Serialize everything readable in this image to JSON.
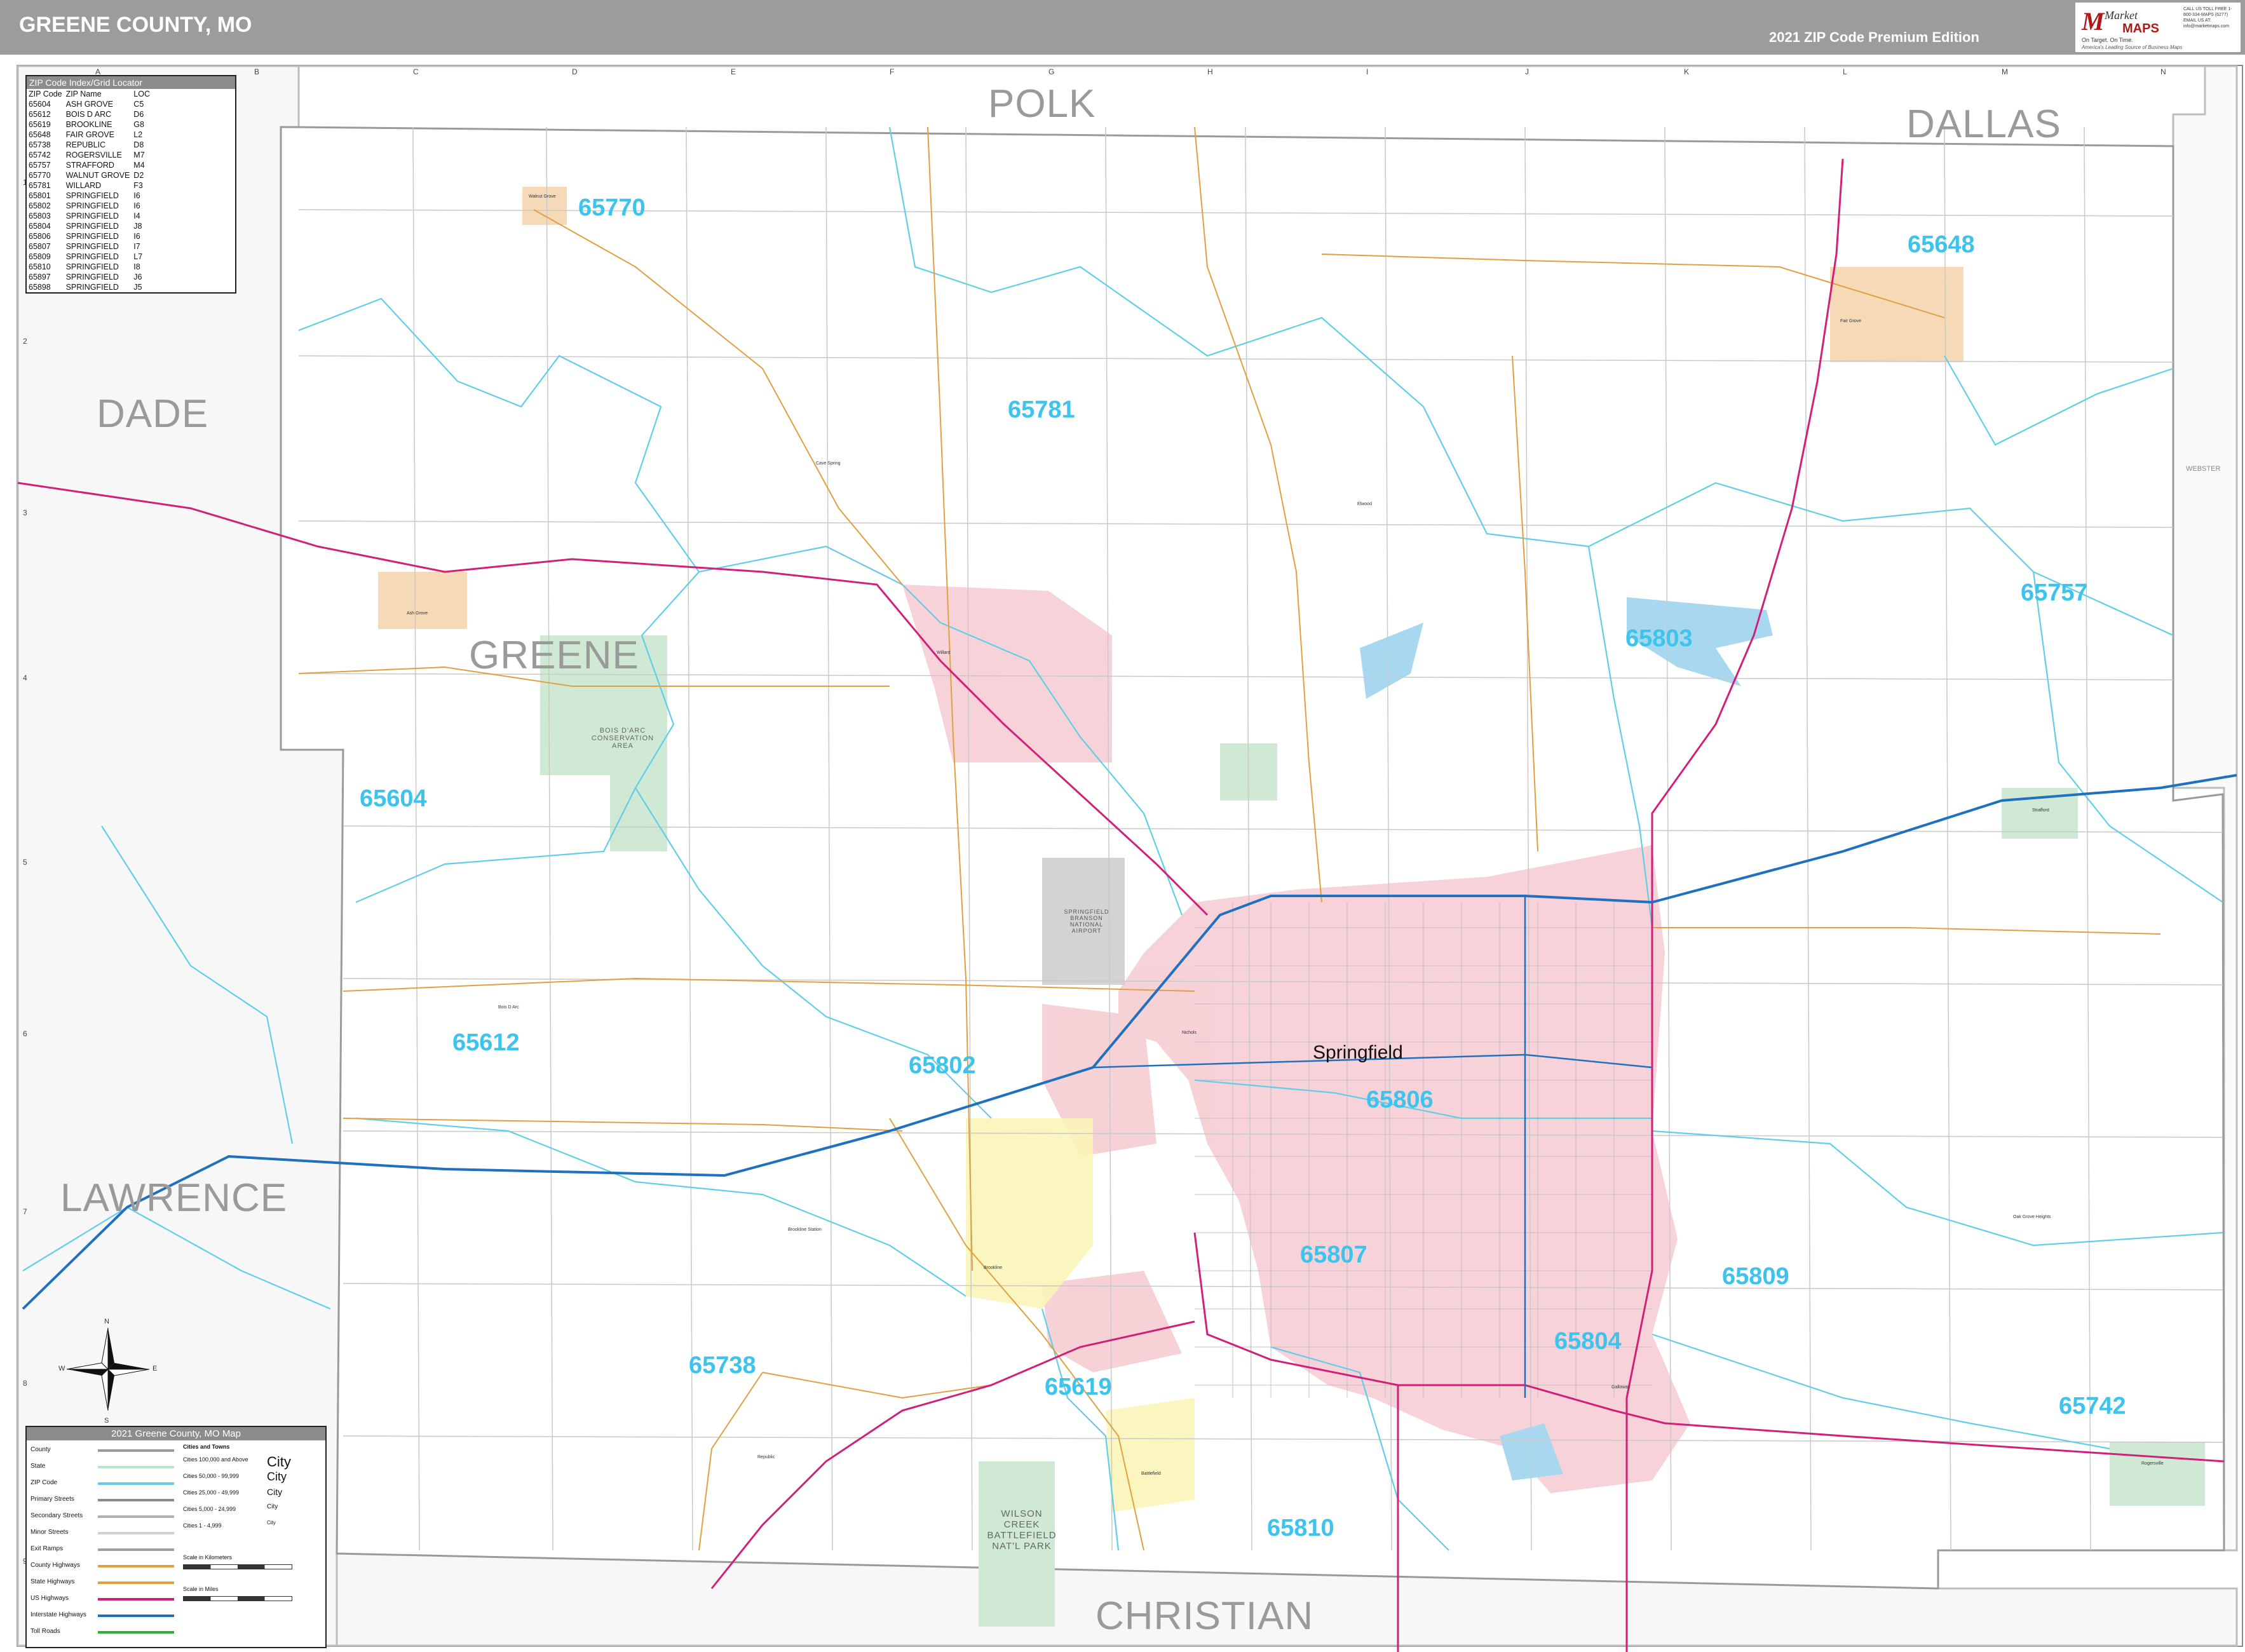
{
  "header": {
    "title": "GREENE COUNTY, MO",
    "edition": "2021 ZIP Code Premium Edition"
  },
  "logo": {
    "market": "Market",
    "maps": "MAPS",
    "tagline1": "On Target. On Time.",
    "tagline2": "America's Leading Source of Business Maps",
    "contact": "CALL US TOLL FREE 1-800-334-MAPS (6277) EMAIL US AT: info@marketmaps.com"
  },
  "grid": {
    "letters": [
      "A",
      "B",
      "C",
      "D",
      "E",
      "F",
      "G",
      "H",
      "I",
      "J",
      "K",
      "L",
      "M",
      "N"
    ],
    "numbers": [
      "1",
      "2",
      "3",
      "4",
      "5",
      "6",
      "7",
      "8",
      "9"
    ]
  },
  "counties": {
    "polk": "POLK",
    "dallas": "DALLAS",
    "dade": "DADE",
    "greene": "GREENE",
    "lawrence": "LAWRENCE",
    "christian": "CHRISTIAN",
    "webster": "WEBSTER"
  },
  "zip_labels": {
    "z65770": "65770",
    "z65648": "65648",
    "z65781": "65781",
    "z65757": "65757",
    "z65803": "65803",
    "z65604": "65604",
    "z65612": "65612",
    "z65802": "65802",
    "z65806": "65806",
    "z65807": "65807",
    "z65809": "65809",
    "z65804": "65804",
    "z65738": "65738",
    "z65619": "65619",
    "z65742": "65742",
    "z65810": "65810"
  },
  "city": {
    "springfield": "Springfield"
  },
  "places": {
    "walnut_grove": "Walnut Grove",
    "fair_grove": "Fair Grove",
    "ash_grove": "Ash Grove",
    "willard": "Willard",
    "strafford": "Strafford",
    "republic": "Republic",
    "rogersville": "Rogersville",
    "battlefield": "Battlefield",
    "brookline": "Brookline",
    "bois_d_arc": "Bois D Arc",
    "cave_spring": "Cave Spring",
    "pleasant_hope": "Elwood",
    "brookline_station": "Brookline Station",
    "galloway": "Galloway",
    "oak_grove_heights": "Oak Grove Heights",
    "nichols": "Nichols"
  },
  "parks": {
    "bois_darc": "BOIS D'ARC\nCONSERVATION\nAREA",
    "wilson_creek": "WILSON\nCREEK\nBATTLEFIELD\nNAT'L PARK",
    "airport": "SPRINGFIELD\nBRANSON\nNATIONAL\nAIRPORT"
  },
  "index": {
    "title": "ZIP Code Index/Grid Locator",
    "headers": [
      "ZIP Code",
      "ZIP Name",
      "LOC"
    ],
    "rows": [
      [
        "65604",
        "ASH GROVE",
        "C5"
      ],
      [
        "65612",
        "BOIS D ARC",
        "D6"
      ],
      [
        "65619",
        "BROOKLINE",
        "G8"
      ],
      [
        "65648",
        "FAIR GROVE",
        "L2"
      ],
      [
        "65738",
        "REPUBLIC",
        "D8"
      ],
      [
        "65742",
        "ROGERSVILLE",
        "M7"
      ],
      [
        "65757",
        "STRAFFORD",
        "M4"
      ],
      [
        "65770",
        "WALNUT GROVE",
        "D2"
      ],
      [
        "65781",
        "WILLARD",
        "F3"
      ],
      [
        "65801",
        "SPRINGFIELD",
        "I6"
      ],
      [
        "65802",
        "SPRINGFIELD",
        "I6"
      ],
      [
        "65803",
        "SPRINGFIELD",
        "I4"
      ],
      [
        "65804",
        "SPRINGFIELD",
        "J8"
      ],
      [
        "65806",
        "SPRINGFIELD",
        "I6"
      ],
      [
        "65807",
        "SPRINGFIELD",
        "I7"
      ],
      [
        "65809",
        "SPRINGFIELD",
        "L7"
      ],
      [
        "65810",
        "SPRINGFIELD",
        "I8"
      ],
      [
        "65897",
        "SPRINGFIELD",
        "J6"
      ],
      [
        "65898",
        "SPRINGFIELD",
        "J5"
      ]
    ]
  },
  "legend": {
    "title": "2021 Greene County, MO Map",
    "items": [
      "County",
      "State",
      "ZIP Code",
      "Primary Streets",
      "Secondary Streets",
      "Minor Streets",
      "Exit Ramps",
      "County Highways",
      "State Highways",
      "US Highways",
      "Interstate Highways",
      "Toll Roads"
    ],
    "colors": [
      "#9a9a9a",
      "#b8e6c8",
      "#5fcfe8",
      "#8a8a8a",
      "#b0b0b0",
      "#d0d0d0",
      "#a0a0a0",
      "#e0a040",
      "#e0a040",
      "#d0207a",
      "#2070c0",
      "#30b030"
    ],
    "cities_title": "Cities and Towns",
    "city_classes": [
      "Cities 100,000 and Above",
      "Cities 50,000 - 99,999",
      "Cities 25,000 - 49,999",
      "Cities 5,000 - 24,999",
      "Cities 1 - 4,999"
    ],
    "city_samples": [
      "City",
      "City",
      "City",
      "City",
      "City"
    ],
    "scale_km": "Scale in Kilometers",
    "scale_mi": "Scale in Miles"
  },
  "compass": {
    "n": "N",
    "s": "S",
    "e": "E",
    "w": "W"
  }
}
